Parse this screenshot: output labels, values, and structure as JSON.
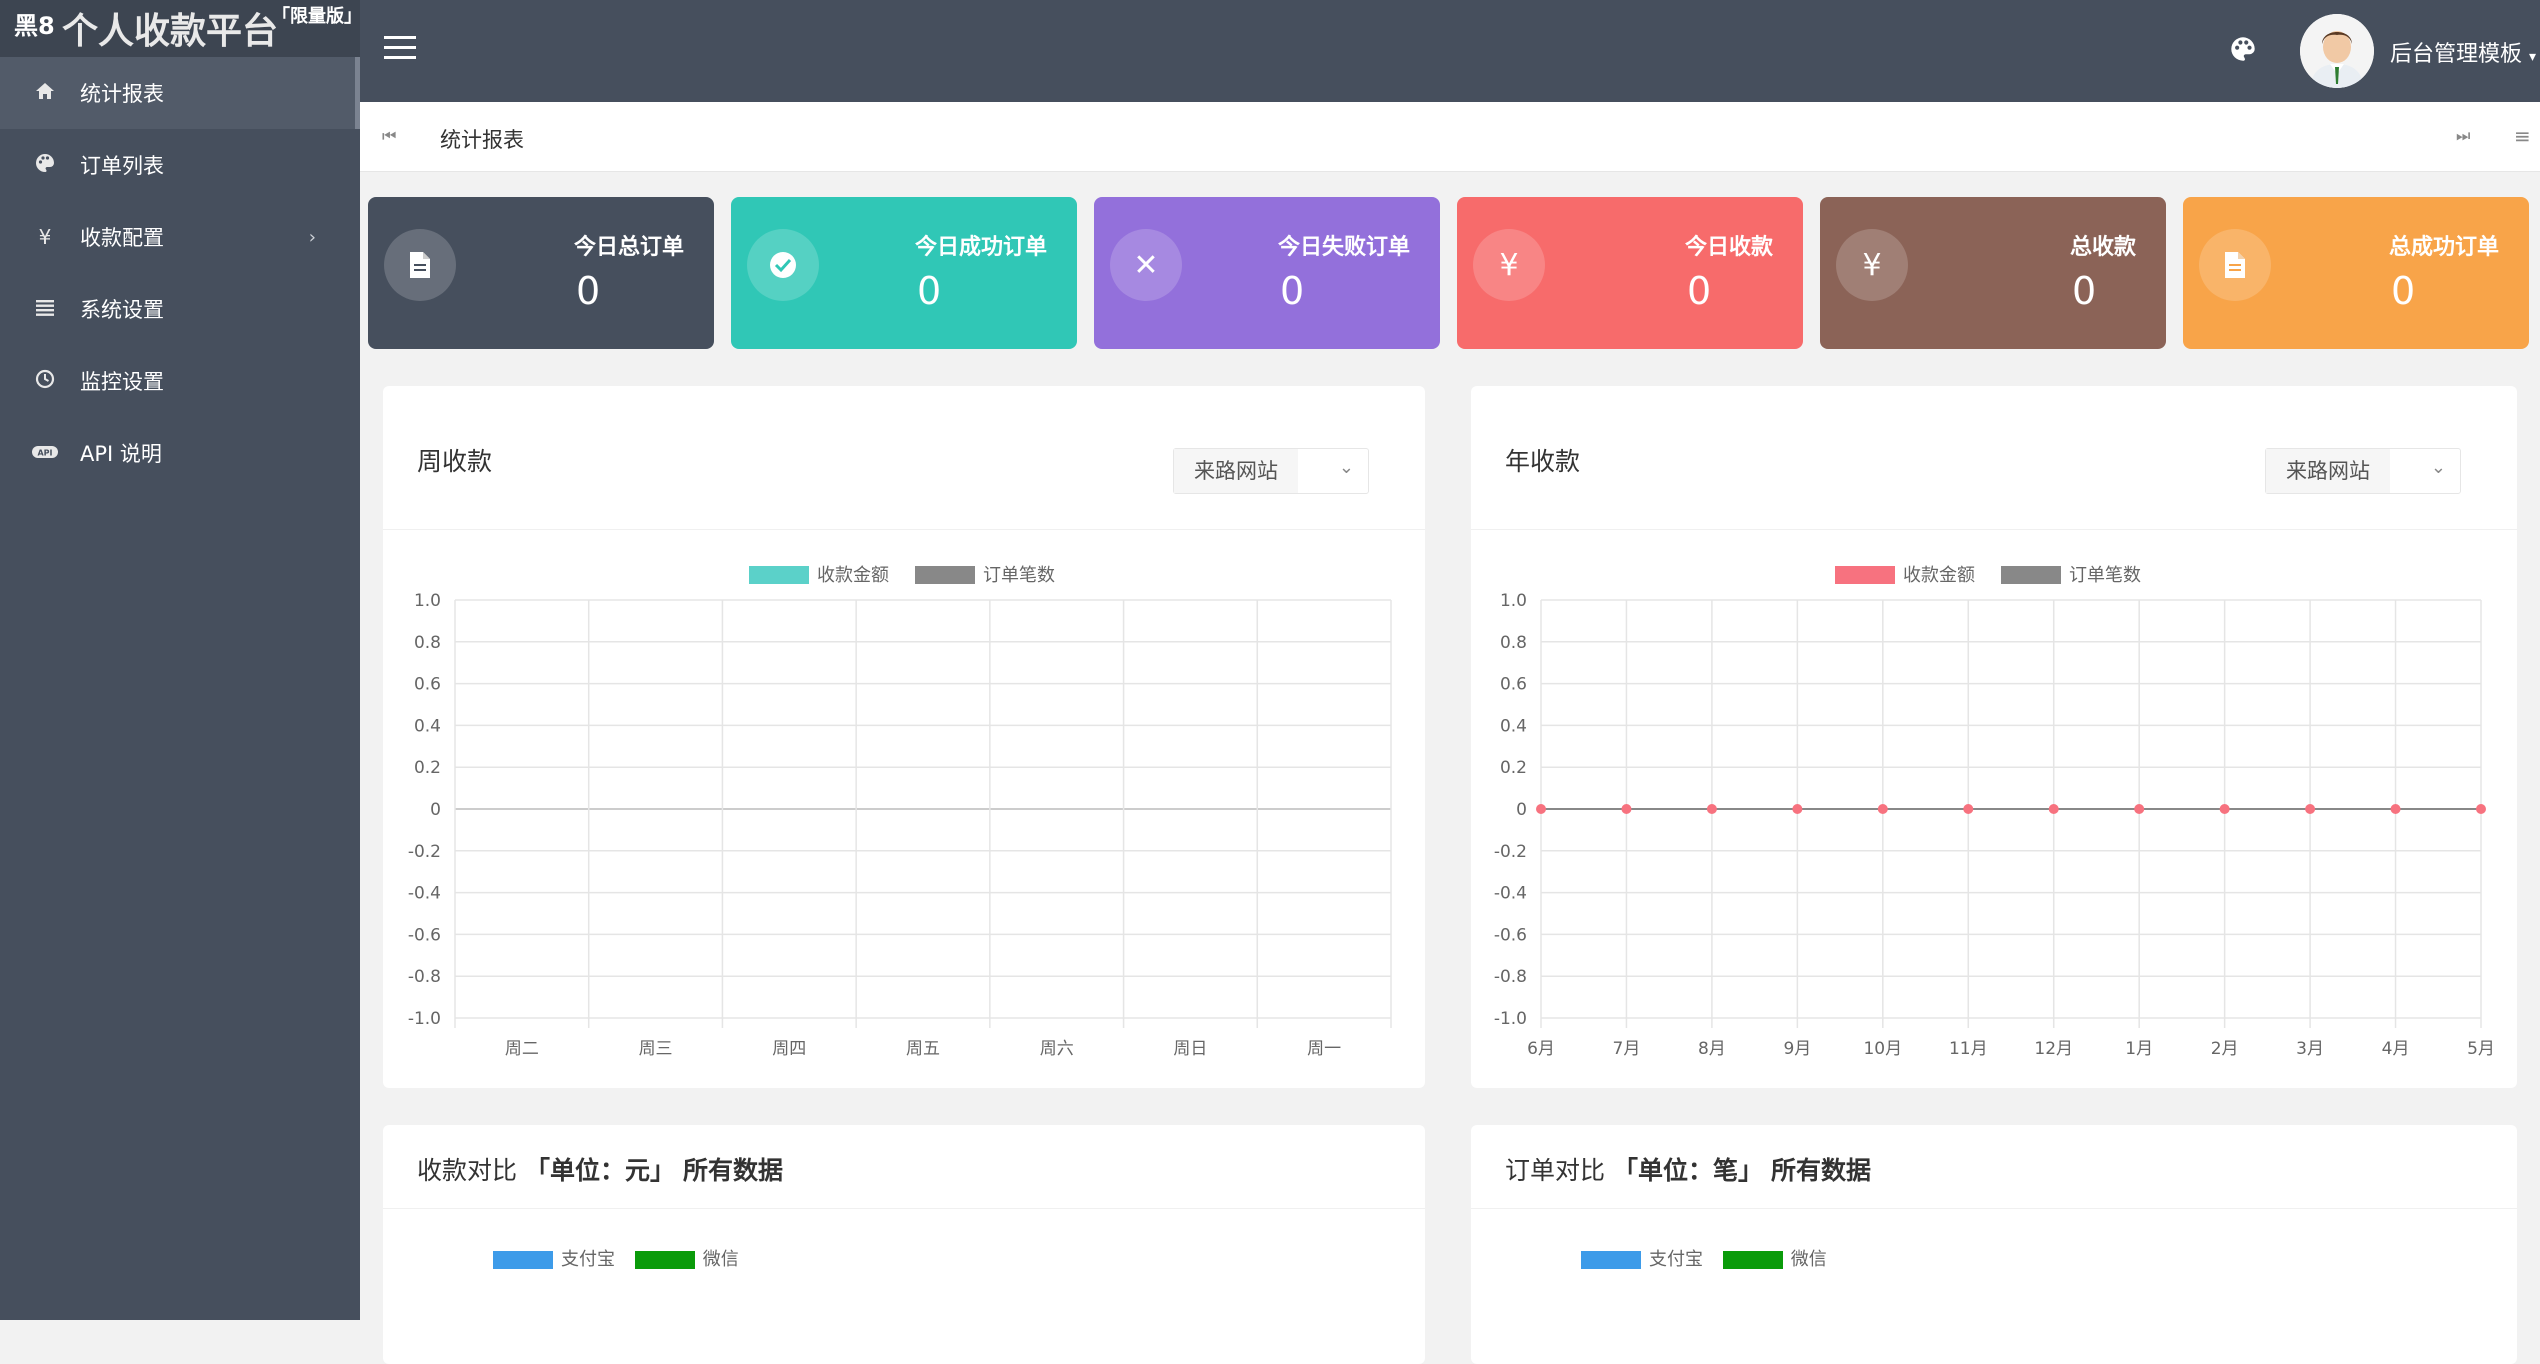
{
  "brand": {
    "prefix": "黑8",
    "name": "个人收款平台",
    "badge": "「限量版」"
  },
  "sidebar": {
    "items": [
      {
        "label": "统计报表",
        "icon": "home-icon",
        "active": true
      },
      {
        "label": "订单列表",
        "icon": "palette-icon"
      },
      {
        "label": "收款配置",
        "icon": "yen-icon",
        "has_children": true
      },
      {
        "label": "系统设置",
        "icon": "list-icon"
      },
      {
        "label": "监控设置",
        "icon": "clock-icon"
      },
      {
        "label": "API 说明",
        "icon": "api-icon"
      }
    ]
  },
  "header": {
    "user_name": "后台管理模板"
  },
  "tabbar": {
    "current": "统计报表"
  },
  "stats": [
    {
      "title": "今日总订单",
      "value": "0",
      "icon": "document-icon",
      "color": "#464f5d"
    },
    {
      "title": "今日成功订单",
      "value": "0",
      "icon": "check-icon",
      "color": "#30c7b6"
    },
    {
      "title": "今日失败订单",
      "value": "0",
      "icon": "close-icon",
      "color": "#9370db"
    },
    {
      "title": "今日收款",
      "value": "0",
      "icon": "yen-icon",
      "color": "#f76b6b"
    },
    {
      "title": "总收款",
      "value": "0",
      "icon": "yen-icon",
      "color": "#8b6357"
    },
    {
      "title": "总成功订单",
      "value": "0",
      "icon": "document-icon",
      "color": "#f8a449"
    }
  ],
  "select_label": "来路网站",
  "week_panel": {
    "title": "周收款"
  },
  "year_panel": {
    "title": "年收款"
  },
  "compare_money": {
    "title": "收款对比",
    "unit": "「单位：元」",
    "scope": "所有数据"
  },
  "compare_orders": {
    "title": "订单对比",
    "unit": "「单位：笔」",
    "scope": "所有数据"
  },
  "compare_legend": {
    "alipay": "支付宝",
    "wechat": "微信",
    "alipay_color": "#3d9be9",
    "wechat_color": "#0a9b0a"
  },
  "chart_data": [
    {
      "type": "bar",
      "categories": [
        "周二",
        "周三",
        "周四",
        "周五",
        "周六",
        "周日",
        "周一"
      ],
      "series": [
        {
          "name": "收款金额",
          "values": [
            0,
            0,
            0,
            0,
            0,
            0,
            0
          ],
          "color": "#5bd1c9"
        },
        {
          "name": "订单笔数",
          "values": [
            0,
            0,
            0,
            0,
            0,
            0,
            0
          ],
          "color": "#888888"
        }
      ],
      "ylim": [
        -1.0,
        1.0
      ],
      "yticks": [
        "1.0",
        "0.8",
        "0.6",
        "0.4",
        "0.2",
        "0",
        "-0.2",
        "-0.4",
        "-0.6",
        "-0.8",
        "-1.0"
      ],
      "grid": true,
      "legend": "top-center"
    },
    {
      "type": "line",
      "categories": [
        "6月",
        "7月",
        "8月",
        "9月",
        "10月",
        "11月",
        "12月",
        "1月",
        "2月",
        "3月",
        "4月",
        "5月"
      ],
      "series": [
        {
          "name": "收款金额",
          "values": [
            0,
            0,
            0,
            0,
            0,
            0,
            0,
            0,
            0,
            0,
            0,
            0
          ],
          "color": "#f7727f"
        },
        {
          "name": "订单笔数",
          "values": [
            0,
            0,
            0,
            0,
            0,
            0,
            0,
            0,
            0,
            0,
            0,
            0
          ],
          "color": "#888888"
        }
      ],
      "ylim": [
        -1.0,
        1.0
      ],
      "yticks": [
        "1.0",
        "0.8",
        "0.6",
        "0.4",
        "0.2",
        "0",
        "-0.2",
        "-0.4",
        "-0.6",
        "-0.8",
        "-1.0"
      ],
      "grid": true,
      "legend": "top-center"
    }
  ]
}
